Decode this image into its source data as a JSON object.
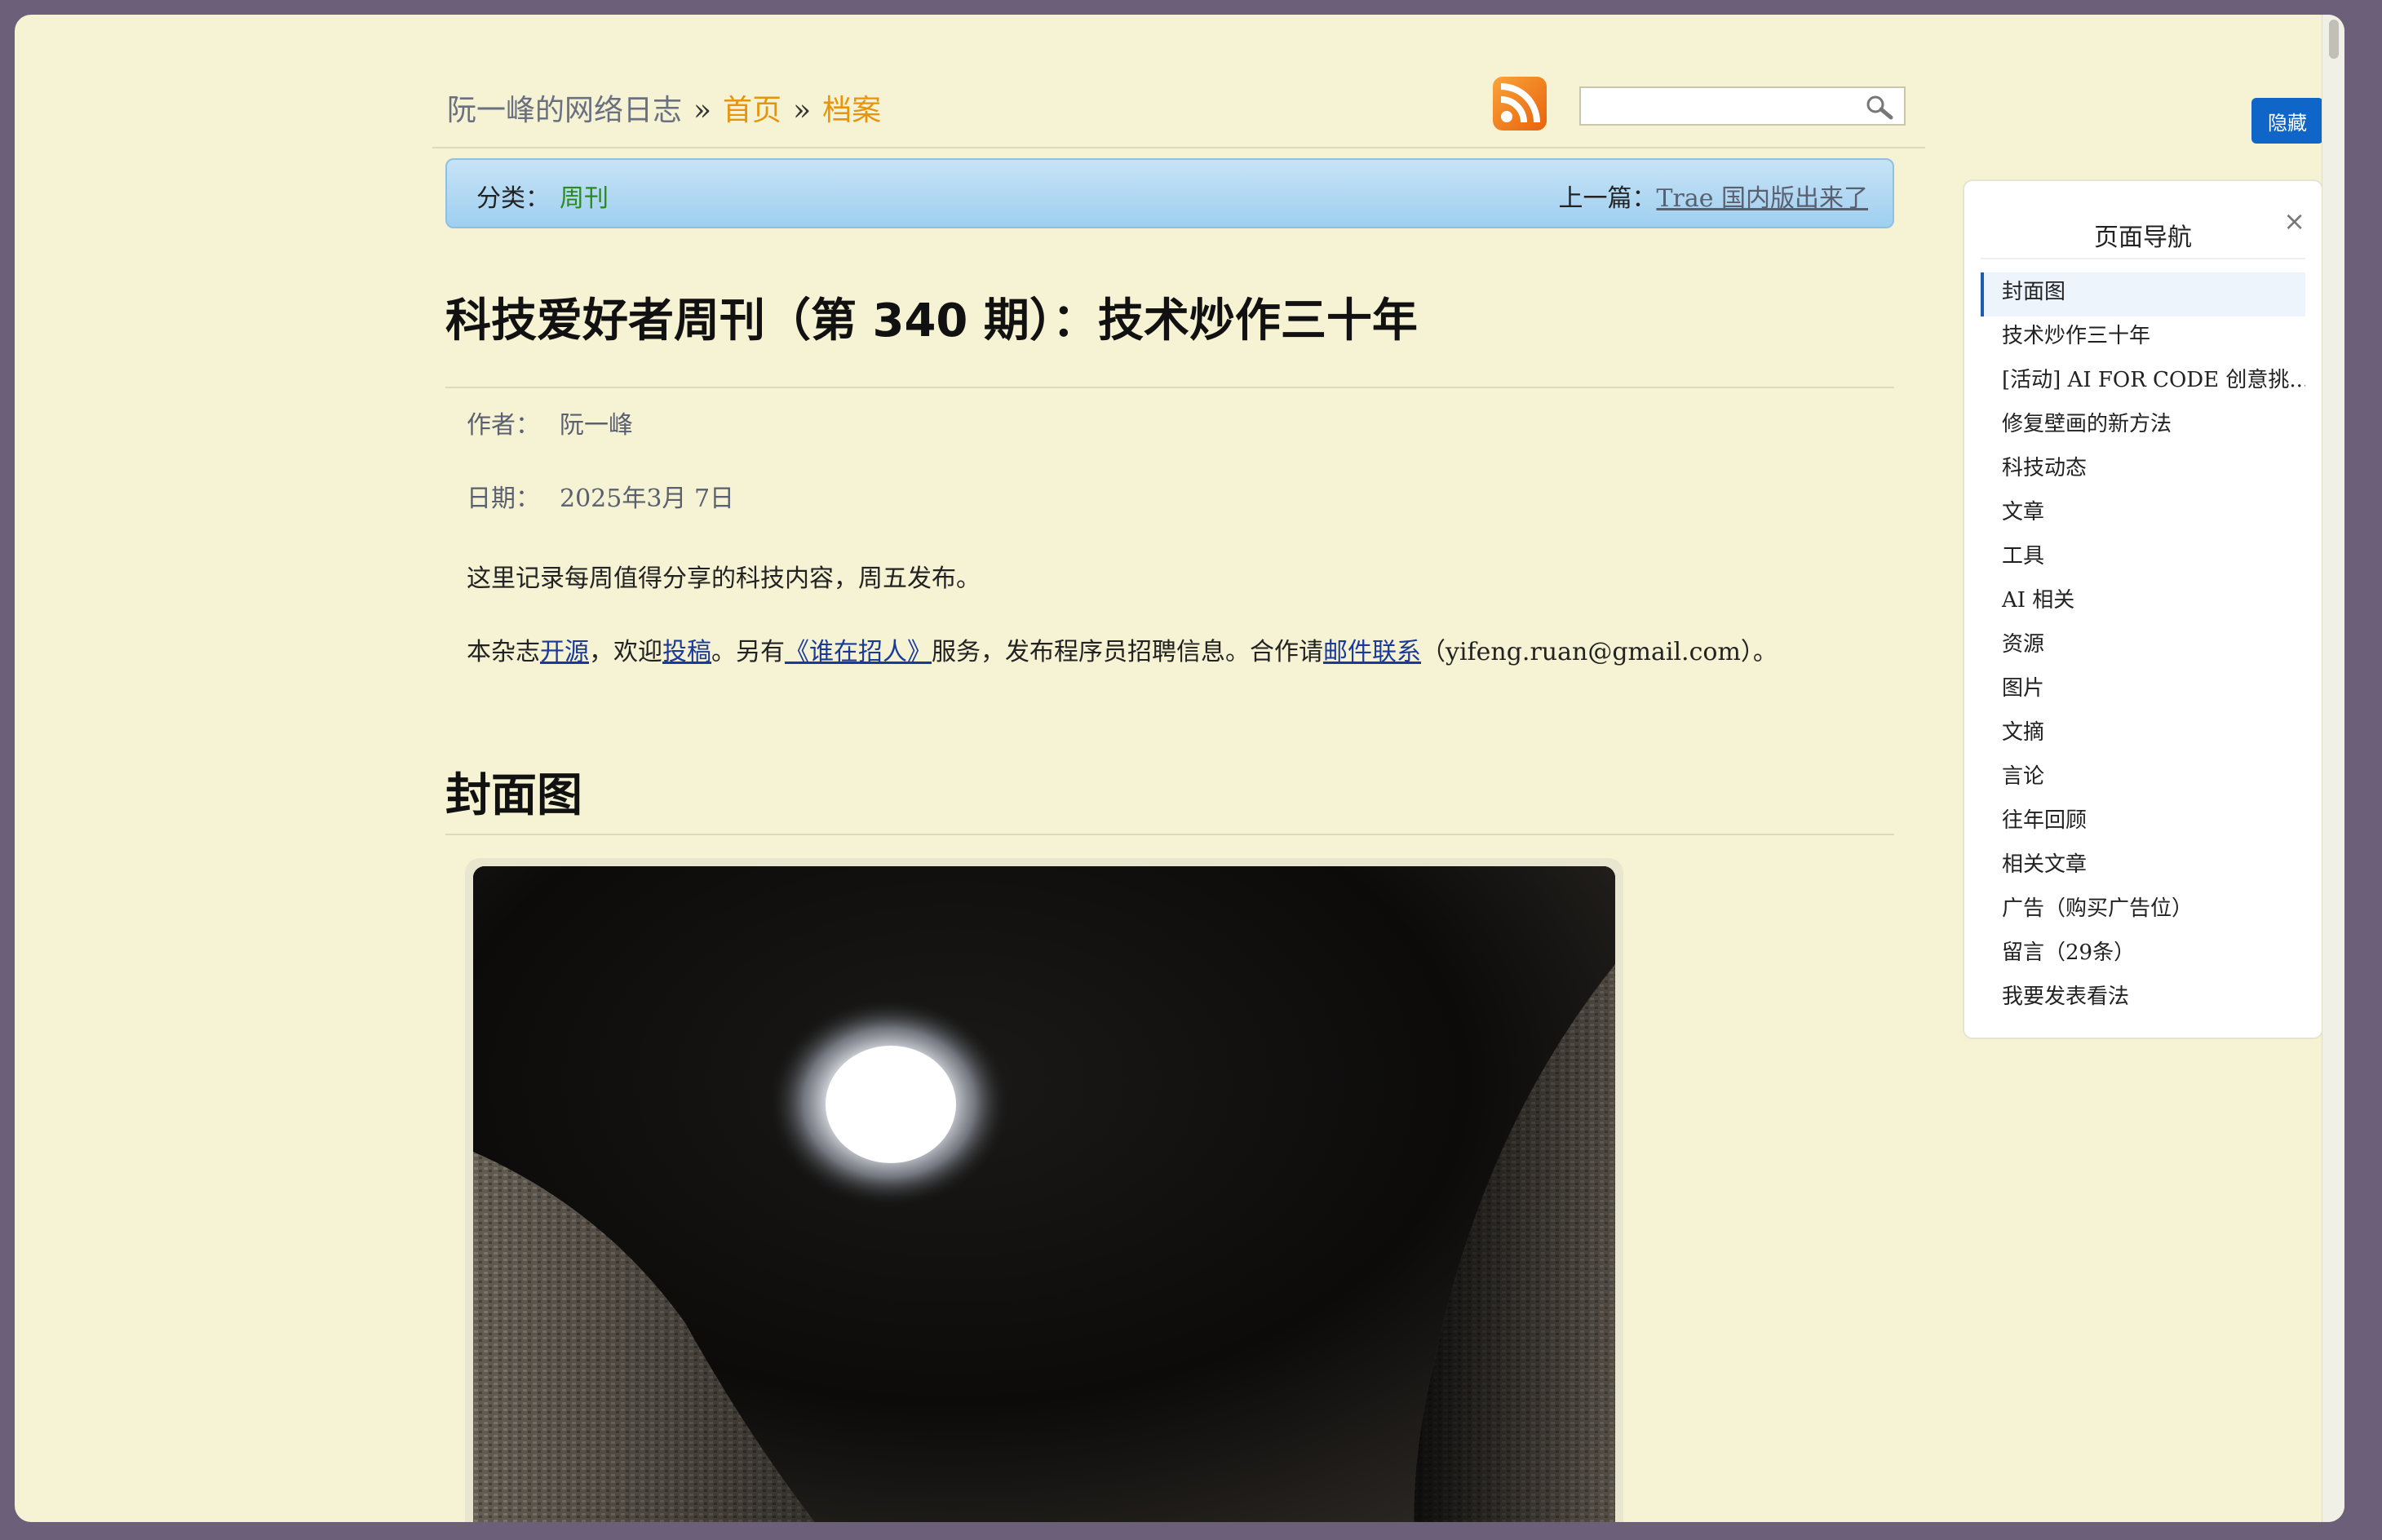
{
  "breadcrumb": {
    "site": "阮一峰的网络日志",
    "sep": "»",
    "home": "首页",
    "archive": "档案"
  },
  "category_bar": {
    "label": "分类：",
    "value": "周刊",
    "prev_label": "上一篇：",
    "prev_title": "Trae 国内版出来了"
  },
  "article": {
    "title": "科技爱好者周刊（第 340 期）：技术炒作三十年",
    "author_label": "作者：",
    "author": "阮一峰",
    "date_label": "日期：",
    "date": "2025年3月 7日",
    "intro": "这里记录每周值得分享的科技内容，周五发布。",
    "p2_a": "本杂志",
    "p2_link1": "开源",
    "p2_b": "，欢迎",
    "p2_link2": "投稿",
    "p2_c": "。另有",
    "p2_link3": "《谁在招人》",
    "p2_d": "服务，发布程序员招聘信息。合作请",
    "p2_link4": "邮件联系",
    "p2_e": "（yifeng.ruan@gmail.com）。",
    "section1": "封面图"
  },
  "hide_button": "隐藏",
  "nav": {
    "title": "页面导航",
    "close": "×",
    "items": [
      "封面图",
      "技术炒作三十年",
      "[活动] AI FOR CODE 创意挑...",
      "修复壁画的新方法",
      "科技动态",
      "文章",
      "工具",
      "AI 相关",
      "资源",
      "图片",
      "文摘",
      "言论",
      "往年回顾",
      "相关文章",
      "广告（购买广告位）",
      "留言（29条）",
      "我要发表看法"
    ]
  },
  "colors": {
    "page_bg": "#f5f3d4",
    "link_orange": "#e8930c",
    "category_green": "#2a8a1e",
    "button_blue": "#0f66c8"
  }
}
